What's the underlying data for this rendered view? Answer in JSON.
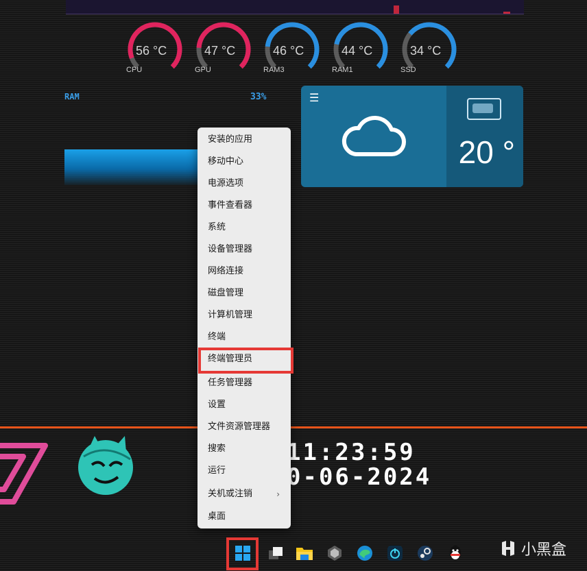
{
  "gauges": [
    {
      "temp": "56 °C",
      "label": "CPU",
      "color": "#e0245e",
      "fraction": 0.56
    },
    {
      "temp": "47 °C",
      "label": "GPU",
      "color": "#e0245e",
      "fraction": 0.47
    },
    {
      "temp": "46 °C",
      "label": "RAM3",
      "color": "#2a8fe0",
      "fraction": 0.46
    },
    {
      "temp": "44 °C",
      "label": "RAM1",
      "color": "#2a8fe0",
      "fraction": 0.44
    },
    {
      "temp": "34 °C",
      "label": "SSD",
      "color": "#2a8fe0",
      "fraction": 0.34
    }
  ],
  "ram": {
    "label": "RAM",
    "percent": "33%"
  },
  "weather": {
    "menu_icon": "hamburger-icon",
    "temperature": "20 °"
  },
  "clock": {
    "time": "11:23:59",
    "date": "0-06-2024"
  },
  "context_menu": {
    "items": [
      {
        "label": "安装的应用"
      },
      {
        "label": "移动中心"
      },
      {
        "label": "电源选项"
      },
      {
        "label": "事件查看器"
      },
      {
        "label": "系统"
      },
      {
        "label": "设备管理器"
      },
      {
        "label": "网络连接"
      },
      {
        "label": "磁盘管理"
      },
      {
        "label": "计算机管理"
      },
      {
        "label": "终端"
      },
      {
        "label": "终端管理员"
      },
      {
        "label": "任务管理器"
      },
      {
        "label": "设置"
      },
      {
        "label": "文件资源管理器"
      },
      {
        "label": "搜索"
      },
      {
        "label": "运行"
      },
      {
        "label": "关机或注销",
        "chevron": "›"
      },
      {
        "label": "桌面"
      }
    ],
    "highlighted_item": "终端管理员"
  },
  "taskbar": {
    "icons": [
      "windows-start-icon",
      "task-view-icon",
      "file-explorer-icon",
      "unity-icon",
      "edge-icon",
      "power-app-icon",
      "steam-icon",
      "qq-icon"
    ]
  },
  "watermark": {
    "text": "小黑盒"
  },
  "colors": {
    "accent_red": "#e53935",
    "orange_line": "#e8541a",
    "weather_bg": "#1a6e96"
  }
}
